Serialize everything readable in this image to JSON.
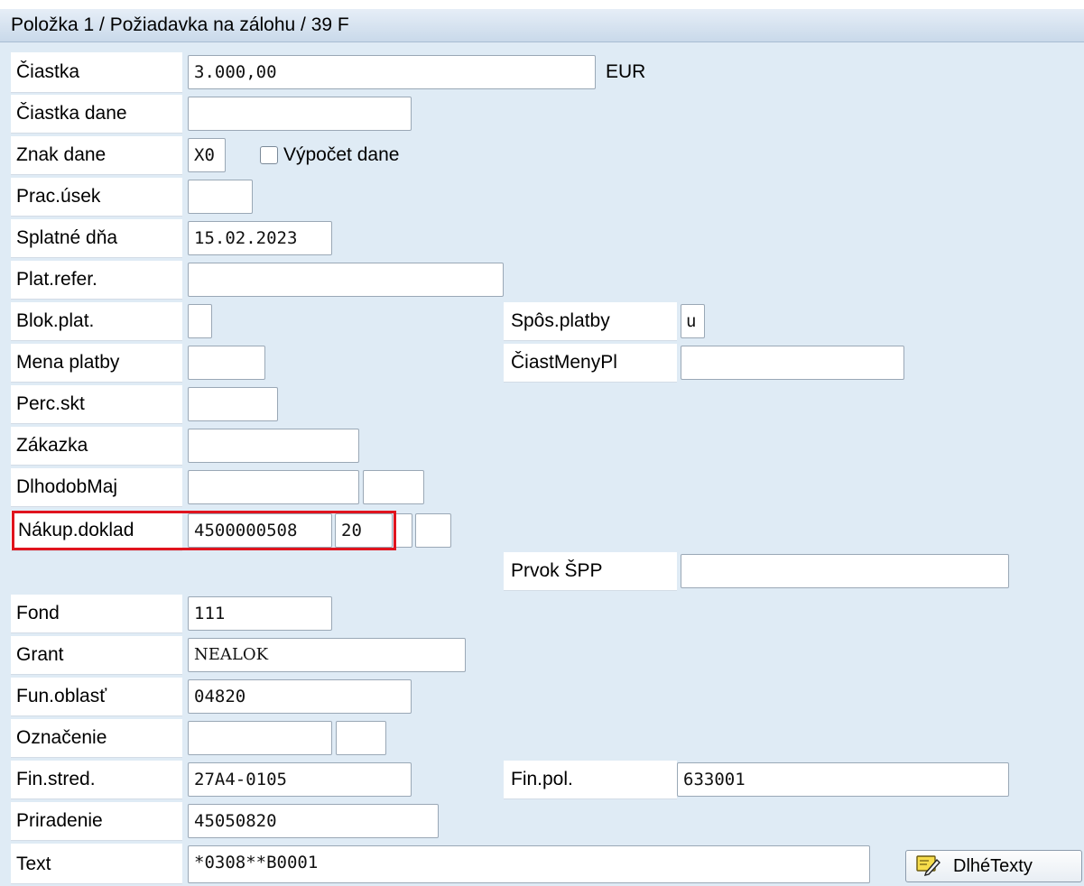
{
  "header": {
    "title": "Položka 1 / Požiadavka na zálohu / 39 F"
  },
  "fields": {
    "ciastka": {
      "label": "Čiastka",
      "value": "3.000,00",
      "currency": "EUR"
    },
    "ciastka_dane": {
      "label": "Čiastka dane",
      "value": ""
    },
    "znak_dane": {
      "label": "Znak dane",
      "value": "X0",
      "checkbox_label": "Výpočet dane",
      "checked": false
    },
    "prac_usek": {
      "label": "Prac.úsek",
      "value": ""
    },
    "splatne_dna": {
      "label": "Splatné dňa",
      "value": "15.02.2023"
    },
    "plat_refer": {
      "label": "Plat.refer.",
      "value": ""
    },
    "blok_plat": {
      "label": "Blok.plat.",
      "value": ""
    },
    "spos_platby": {
      "label": "Spôs.platby",
      "value": "u"
    },
    "mena_platby": {
      "label": "Mena platby",
      "value": ""
    },
    "ciast_meny_pl": {
      "label": "ČiastMenyPl",
      "value": ""
    },
    "perc_skt": {
      "label": "Perc.skt",
      "value": ""
    },
    "zakazka": {
      "label": "Zákazka",
      "value": ""
    },
    "dlhodob_maj": {
      "label": "DlhodobMaj",
      "value": "",
      "value2": ""
    },
    "nakup_doklad": {
      "label": "Nákup.doklad",
      "value": "4500000508",
      "value2": "20",
      "value3": "",
      "value4": ""
    },
    "prvok_spp": {
      "label": "Prvok ŠPP",
      "value": ""
    },
    "fond": {
      "label": "Fond",
      "value": "111"
    },
    "grant": {
      "label": "Grant",
      "value": "NEALOK"
    },
    "fun_oblast": {
      "label": "Fun.oblasť",
      "value": "04820"
    },
    "oznacenie": {
      "label": "Označenie",
      "value": "",
      "value2": ""
    },
    "fin_stred": {
      "label": "Fin.stred.",
      "value": "27A4-0105"
    },
    "fin_pol": {
      "label": "Fin.pol.",
      "value": "633001"
    },
    "priradenie": {
      "label": "Priradenie",
      "value": "45050820"
    },
    "text": {
      "label": "Text",
      "value": "*0308**B0001"
    }
  },
  "buttons": {
    "dlhe_texty": "DlhéTexty"
  },
  "icons": {
    "dlhe_texty_icon": "pencil-note-icon"
  },
  "colors": {
    "background": "#dfebf5",
    "highlight": "#e0141e"
  }
}
